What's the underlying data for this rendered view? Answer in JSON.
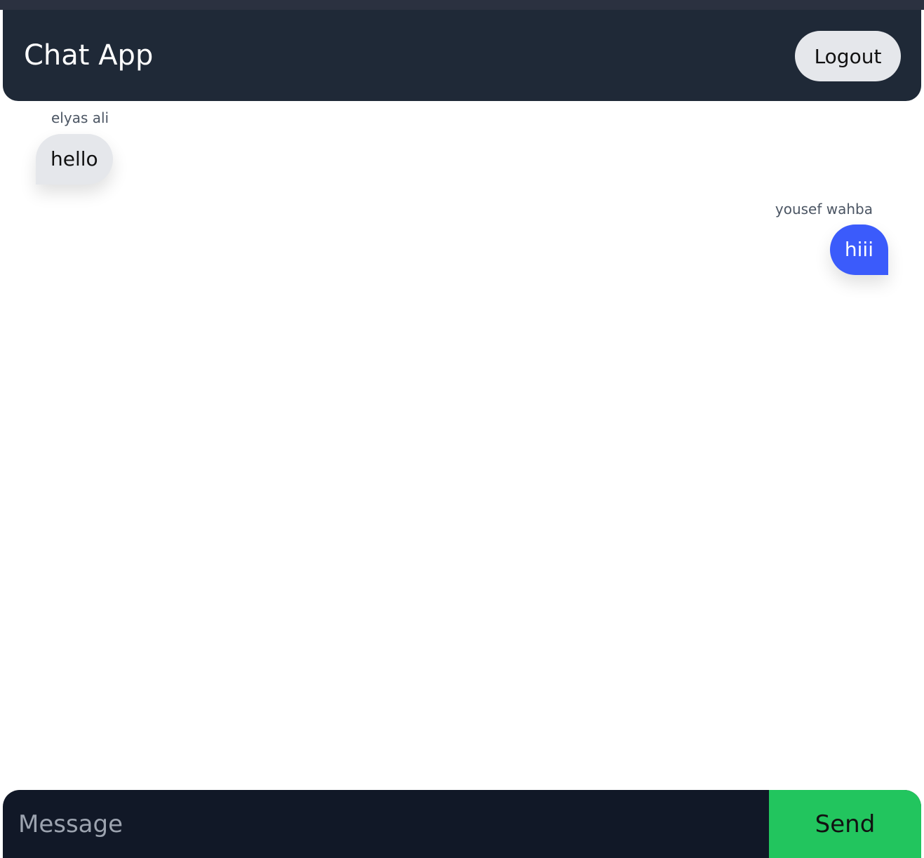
{
  "header": {
    "title": "Chat App",
    "logout_label": "Logout"
  },
  "messages": [
    {
      "sender": "elyas ali",
      "text": "hello",
      "side": "left"
    },
    {
      "sender": "yousef wahba",
      "text": "hiii",
      "side": "right"
    }
  ],
  "composer": {
    "placeholder": "Message",
    "value": "",
    "send_label": "Send"
  },
  "colors": {
    "header_bg": "#1f2937",
    "incoming_bubble": "#e5e7eb",
    "outgoing_bubble": "#3b5bfb",
    "composer_bg": "#111827",
    "send_button": "#22c55e"
  }
}
